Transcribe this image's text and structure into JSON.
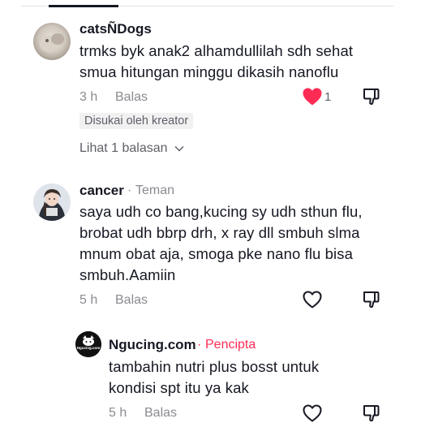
{
  "colors": {
    "like_active": "#fe2c55",
    "creator_tag": "#fe2c55",
    "muted_text": "#8a8b91",
    "primary_text": "#161823",
    "badge_bg": "#f1f1f2"
  },
  "comments": [
    {
      "username": "catsÑDogs",
      "text_lines": [
        "trmks byk anak2 alhamdullilah sdh sehat",
        "smua hitungan minggu dikasih nanoflu"
      ],
      "time": "3 h",
      "reply_label": "Balas",
      "like_count": "1",
      "liked": true,
      "creator_badge": "Disukai oleh kreator",
      "view_replies": "Lihat 1 balasan",
      "icons": [
        "heart-filled-icon",
        "dislike-icon",
        "chevron-down-icon"
      ]
    },
    {
      "username": "cancer",
      "separator": "·",
      "tag": "Teman",
      "text_lines": [
        "saya udh co bang,kucing sy udh sthun flu,",
        "brobat udh bbrp drh, x ray dll smbuh slma",
        "mnum obat aja, smoga pke nano flu bisa",
        "smbuh.Aamiin"
      ],
      "time": "5 h",
      "reply_label": "Balas",
      "liked": false,
      "icons": [
        "heart-outline-icon",
        "dislike-icon"
      ]
    },
    {
      "username": "Ngucing.com",
      "separator": "·",
      "tag": "Pencipta",
      "avatar_text": "Ngucing.com",
      "text_lines": [
        "tambahin nutri plus bosst untuk",
        "kondisi spt itu ya kak"
      ],
      "time": "5 h",
      "reply_label": "Balas",
      "liked": false,
      "icons": [
        "heart-outline-icon",
        "dislike-icon"
      ]
    }
  ]
}
